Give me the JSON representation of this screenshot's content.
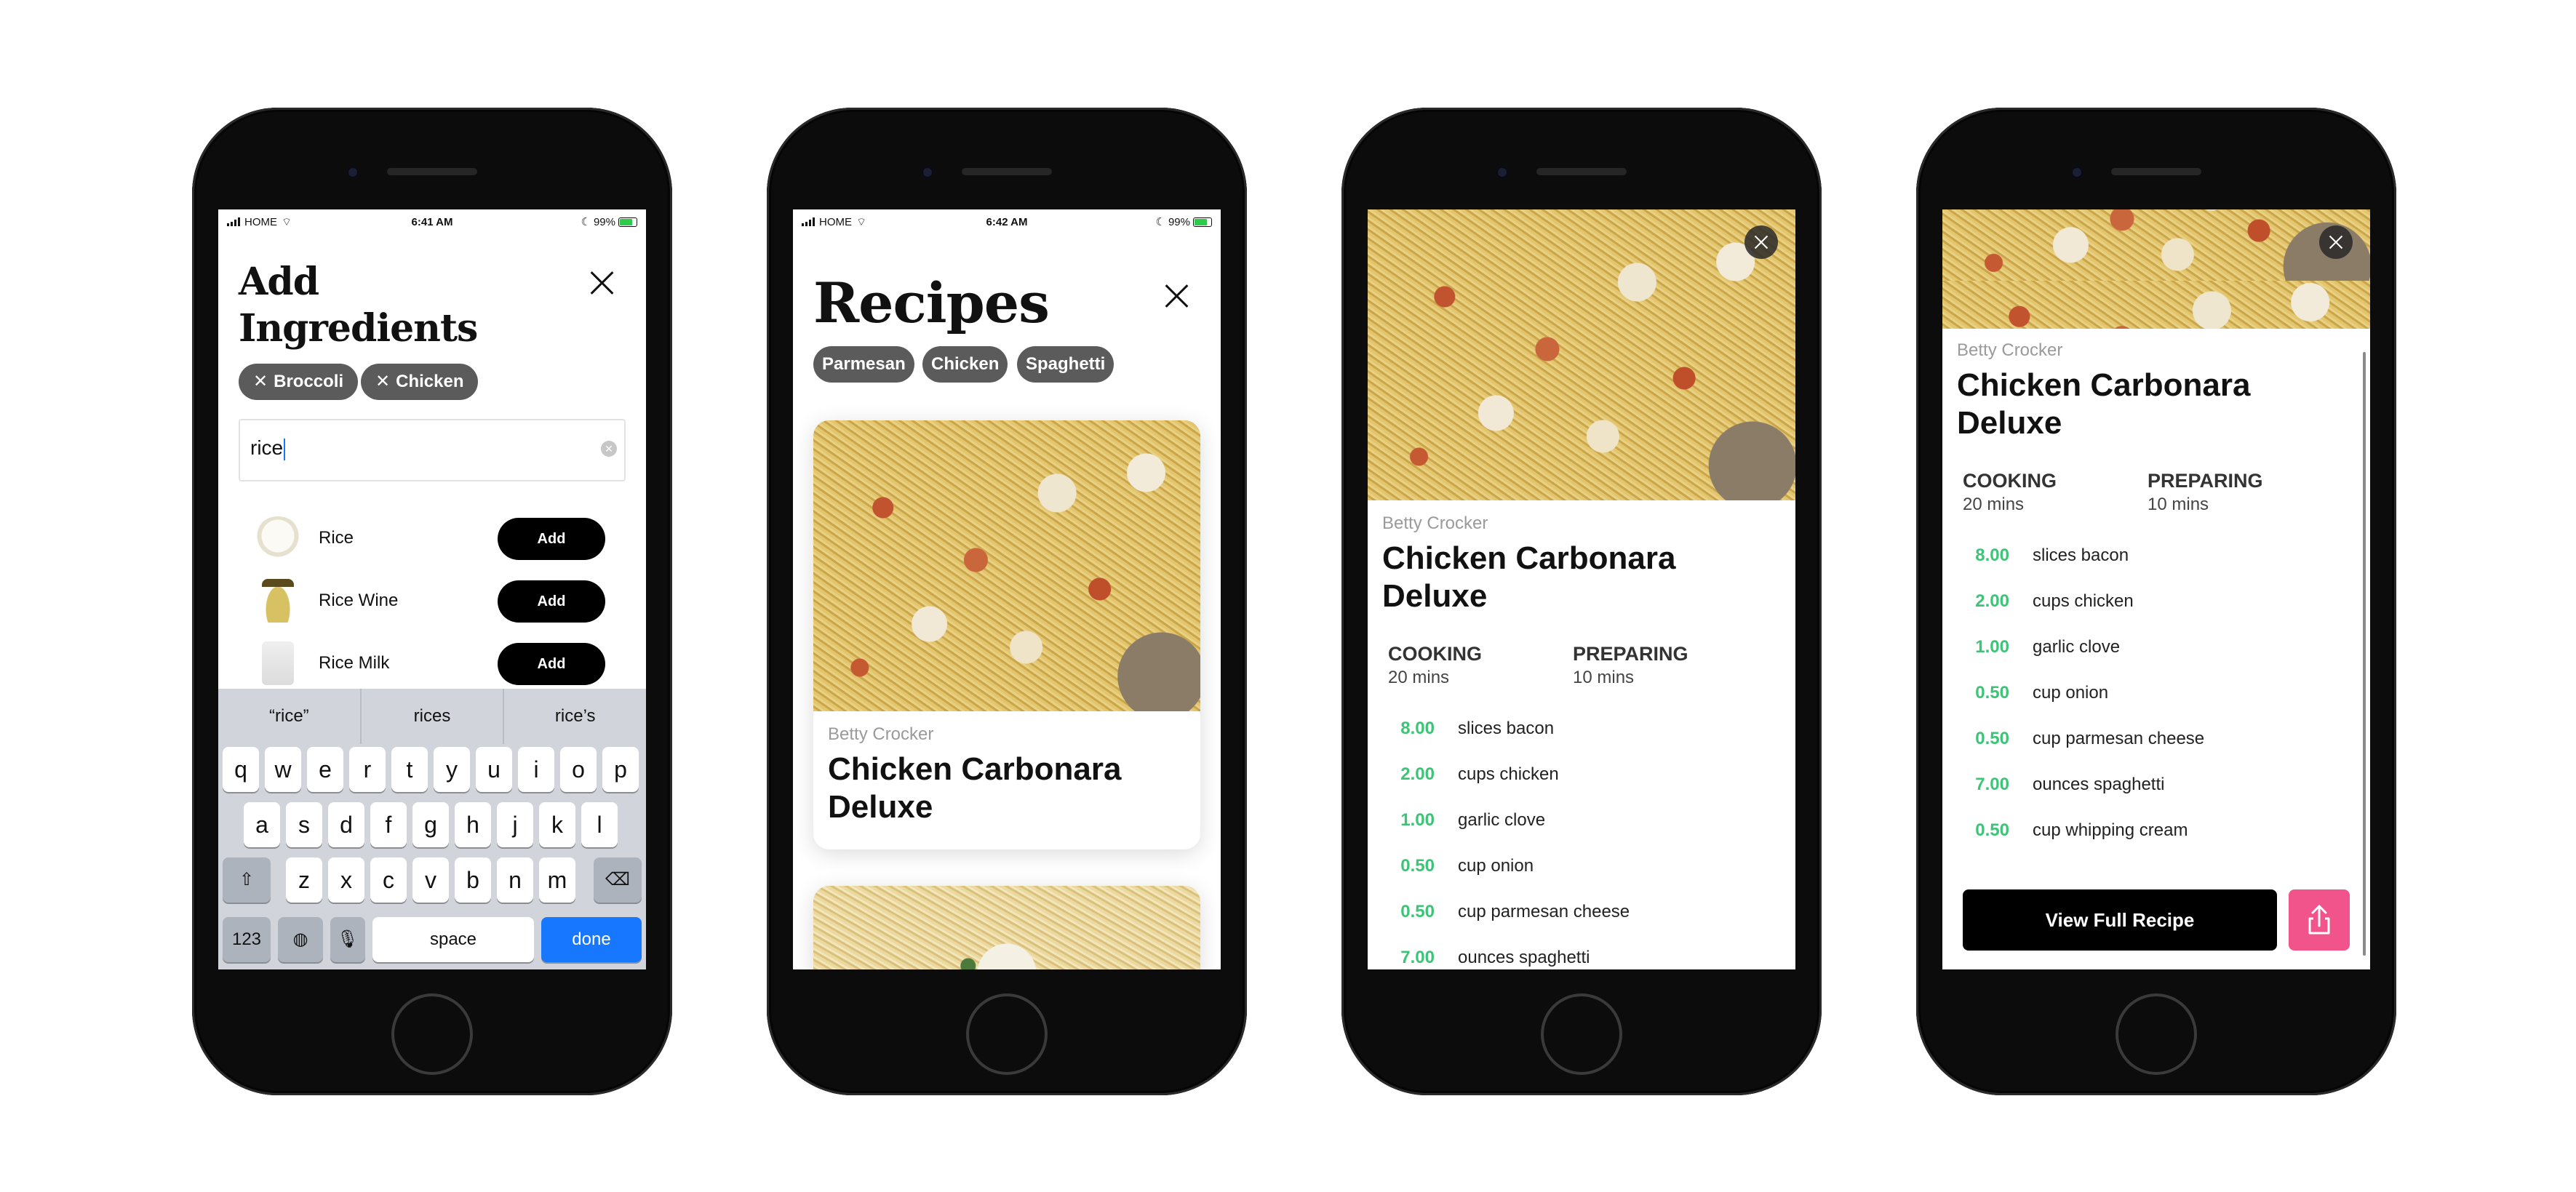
{
  "status_bar_1": {
    "carrier": "HOME",
    "time": "6:41 AM",
    "battery": "99%"
  },
  "status_bar_2": {
    "carrier": "HOME",
    "time": "6:42 AM",
    "battery": "99%"
  },
  "add_ingredients": {
    "title_line1": "Add",
    "title_line2": "Ingredients",
    "selected": [
      "Broccoli",
      "Chicken"
    ],
    "search_value": "rice",
    "results": [
      {
        "name": "Rice",
        "button": "Add"
      },
      {
        "name": "Rice Wine",
        "button": "Add"
      },
      {
        "name": "Rice Milk",
        "button": "Add"
      }
    ],
    "suggestions": [
      "“rice”",
      "rices",
      "rice’s"
    ],
    "keyboard": {
      "row1": [
        "q",
        "w",
        "e",
        "r",
        "t",
        "y",
        "u",
        "i",
        "o",
        "p"
      ],
      "row2": [
        "a",
        "s",
        "d",
        "f",
        "g",
        "h",
        "j",
        "k",
        "l"
      ],
      "row3": [
        "z",
        "x",
        "c",
        "v",
        "b",
        "n",
        "m"
      ],
      "numbers": "123",
      "space": "space",
      "done": "done"
    }
  },
  "recipes": {
    "title": "Recipes",
    "filters": [
      "Parmesan",
      "Chicken",
      "Spaghetti"
    ],
    "card": {
      "author": "Betty Crocker",
      "title_line1": "Chicken Carbonara",
      "title_line2": "Deluxe"
    }
  },
  "detail": {
    "author": "Betty Crocker",
    "title_line1": "Chicken Carbonara",
    "title_line2": "Deluxe",
    "cooking_label": "COOKING",
    "cooking_value": "20 mins",
    "preparing_label": "PREPARING",
    "preparing_value": "10 mins",
    "ingredients": [
      {
        "amount": "8.00",
        "item": "slices bacon"
      },
      {
        "amount": "2.00",
        "item": "cups chicken"
      },
      {
        "amount": "1.00",
        "item": "garlic clove"
      },
      {
        "amount": "0.50",
        "item": "cup onion"
      },
      {
        "amount": "0.50",
        "item": "cup parmesan cheese"
      },
      {
        "amount": "7.00",
        "item": "ounces spaghetti"
      },
      {
        "amount": "0.50",
        "item": "cup whipping cream"
      }
    ],
    "view_button": "View Full Recipe"
  },
  "colors": {
    "accent_green": "#3cc477",
    "share_pink": "#f0548a",
    "keyboard_blue": "#1778ff"
  }
}
